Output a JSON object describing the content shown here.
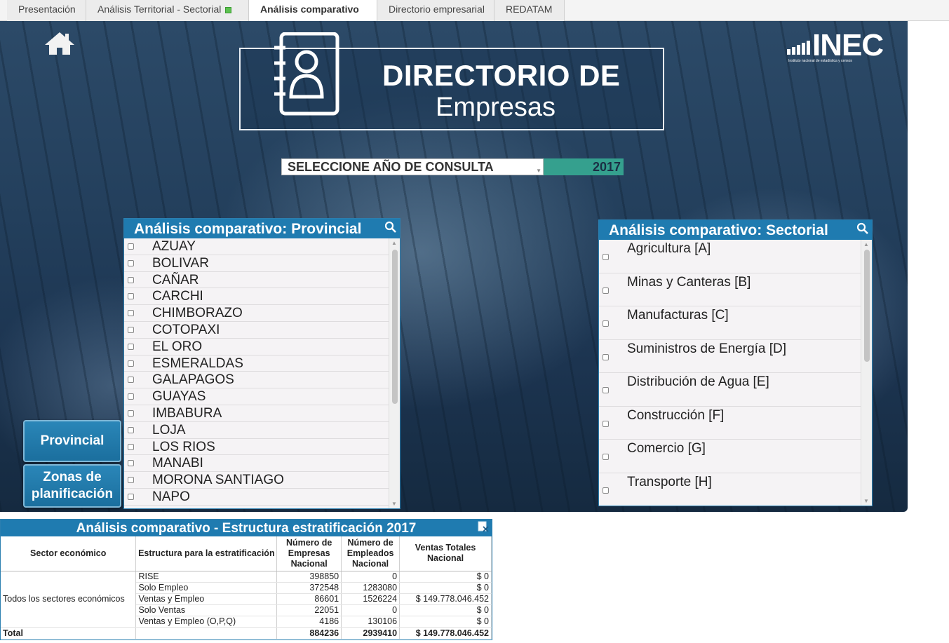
{
  "tabs": [
    {
      "label": "Presentación"
    },
    {
      "label": "Análisis Territorial - Sectorial"
    },
    {
      "label": "Análisis comparativo"
    },
    {
      "label": "Directorio empresarial"
    },
    {
      "label": "REDATAM"
    }
  ],
  "logo": {
    "line1": "DIRECTORIO DE",
    "line2": "Empresas"
  },
  "inec": {
    "name": "INEC",
    "subtitle": "Instituto nacional de estadística y censos"
  },
  "year_selector": {
    "label": "SELECCIONE AÑO DE CONSULTA",
    "value": "2017"
  },
  "provincial": {
    "title": "Análisis comparativo: Provincial",
    "items": [
      "AZUAY",
      "BOLIVAR",
      "CAÑAR",
      "CARCHI",
      "CHIMBORAZO",
      "COTOPAXI",
      "EL ORO",
      "ESMERALDAS",
      "GALAPAGOS",
      "GUAYAS",
      "IMBABURA",
      "LOJA",
      "LOS RIOS",
      "MANABI",
      "MORONA SANTIAGO",
      "NAPO"
    ]
  },
  "sectorial": {
    "title": "Análisis comparativo: Sectorial",
    "items": [
      "Agricultura [A]",
      "Minas y Canteras [B]",
      "Manufacturas [C]",
      "Suministros de Energía [D]",
      "Distribución de Agua [E]",
      "Construcción [F]",
      "Comercio [G]",
      "Transporte [H]"
    ]
  },
  "side_buttons": {
    "provincial": "Provincial",
    "zonas_line1": "Zonas de",
    "zonas_line2": "planificación"
  },
  "table": {
    "title": "Análisis comparativo - Estructura estratificación 2017",
    "headers": {
      "sector": "Sector económico",
      "estructura": "Estructura para la estratificación",
      "empresas": "Número de Empresas Nacional",
      "empleados": "Número de Empleados Nacional",
      "ventas": "Ventas Totales Nacional"
    },
    "sector_label": "Todos los sectores económicos",
    "rows": [
      {
        "estructura": "RISE",
        "empresas": "398850",
        "empleados": "0",
        "ventas": "$ 0"
      },
      {
        "estructura": "Solo Empleo",
        "empresas": "372548",
        "empleados": "1283080",
        "ventas": "$ 0"
      },
      {
        "estructura": "Ventas y Empleo",
        "empresas": "86601",
        "empleados": "1526224",
        "ventas": "$ 149.778.046.452"
      },
      {
        "estructura": "Solo Ventas",
        "empresas": "22051",
        "empleados": "0",
        "ventas": "$ 0"
      },
      {
        "estructura": "Ventas y Empleo (O,P,Q)",
        "empresas": "4186",
        "empleados": "130106",
        "ventas": "$ 0"
      }
    ],
    "total": {
      "label": "Total",
      "empresas": "884236",
      "empleados": "2939410",
      "ventas": "$ 149.778.046.452"
    }
  }
}
